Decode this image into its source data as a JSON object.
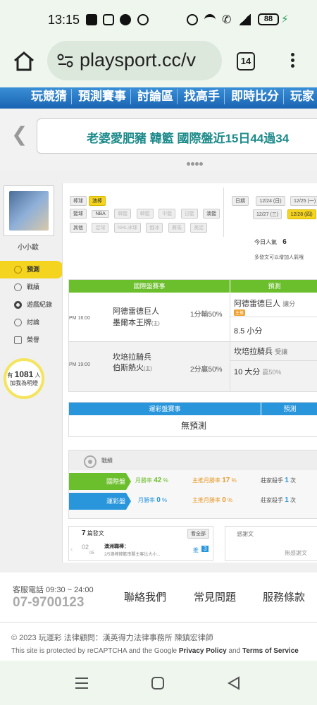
{
  "status": {
    "time": "13:15",
    "battery": "88"
  },
  "browser": {
    "url": "playsport.cc/v",
    "tab_count": "14"
  },
  "nav": [
    "玩競猜",
    "預測賽事",
    "討論區",
    "找高手",
    "即時比分",
    "玩家"
  ],
  "banner": {
    "text": "老婆愛肥豬 韓籃 國際盤近15日44過34"
  },
  "filters": {
    "ball_label": "棒球",
    "ball_tags": [
      "澳棒"
    ],
    "basket_label": "籃球",
    "basket_tags": [
      "NBA",
      "韓籃",
      "韓籃",
      "中籃",
      "日籃",
      "澳籃"
    ],
    "other_label": "其他",
    "other_tags": [
      "足球",
      "NHL冰球",
      "俄冰",
      "賽馬",
      "美足"
    ]
  },
  "dates": {
    "label": "日期",
    "items": [
      "12/24 (日)",
      "12/25 (一)",
      "12/27 (三)",
      "12/28 (四)"
    ]
  },
  "popularity": {
    "label": "今日人氣",
    "value": "6",
    "note": "多發文可以增加人氣哦"
  },
  "user": {
    "name": "小小歐",
    "fans_prefix": "有",
    "fans_count": "1081",
    "fans_suffix": "人",
    "fans_note": "加我為明燈"
  },
  "side_menu": [
    "預測",
    "戰績",
    "遊戲紀錄",
    "討論",
    "榮譽"
  ],
  "intl": {
    "head_left": "國際盤賽事",
    "head_right": "預測",
    "games": [
      {
        "time": "PM 16:00",
        "home": "阿德雷德巨人",
        "away": "墨爾本王牌",
        "away_sub": "(主)",
        "line": "1分輸50%",
        "pick1": "阿德雷德巨人",
        "pick1_note": "讓分",
        "badge": "主推",
        "pick2": "8.5 小分",
        "pick2_note": ""
      },
      {
        "time": "PM 19:00",
        "home": "坎培拉騎兵",
        "away": "伯斯熱火",
        "away_sub": "(主)",
        "line": "2分贏50%",
        "pick1": "坎培拉騎兵",
        "pick1_note": "受讓",
        "badge": "",
        "pick2": "10 大分",
        "pick2_note": "贏50%"
      }
    ]
  },
  "lottery": {
    "head_left": "運彩盤賽事",
    "head_right": "預測",
    "empty": "無預測"
  },
  "record": {
    "title": "戰績",
    "rows": [
      {
        "name": "國際盤",
        "monthly_label": "月勝率",
        "monthly": "42",
        "pct": "%",
        "main_label": "主推月勝率",
        "main": "17",
        "main_pct": "%",
        "streak_label": "莊家殺手",
        "streak": "1",
        "unit": "次"
      },
      {
        "name": "運彩盤",
        "monthly_label": "月勝率",
        "monthly": "0",
        "pct": "%",
        "main_label": "主推月勝率",
        "main": "0",
        "main_pct": "%",
        "streak_label": "莊家殺手",
        "streak": "1",
        "unit": "次"
      }
    ]
  },
  "posts": {
    "count": "7",
    "label": "篇發文",
    "view_all": "看全部",
    "date_top": "02",
    "date_bottom": "05",
    "author": "澳洲職棒：",
    "snippet": "2/5澳棒韓籃串關主客比大小...",
    "push_label": "推",
    "push_count": "3"
  },
  "thanks": {
    "title": "感謝文",
    "empty": "無感謝文"
  },
  "footer": {
    "phone_label": "客服電話 09:30 ~ 24:00",
    "phone": "07-9700123",
    "links": [
      "聯絡我們",
      "常見問題",
      "服務條款"
    ],
    "copyright": "© 2023 玩運彩 法律顧問：漢英得力法律事務所 陳鎮宏律師",
    "captcha_prefix": "This site is protected by reCAPTCHA and the Google ",
    "privacy": "Privacy Policy",
    "and": " and ",
    "terms": "Terms of Service"
  }
}
